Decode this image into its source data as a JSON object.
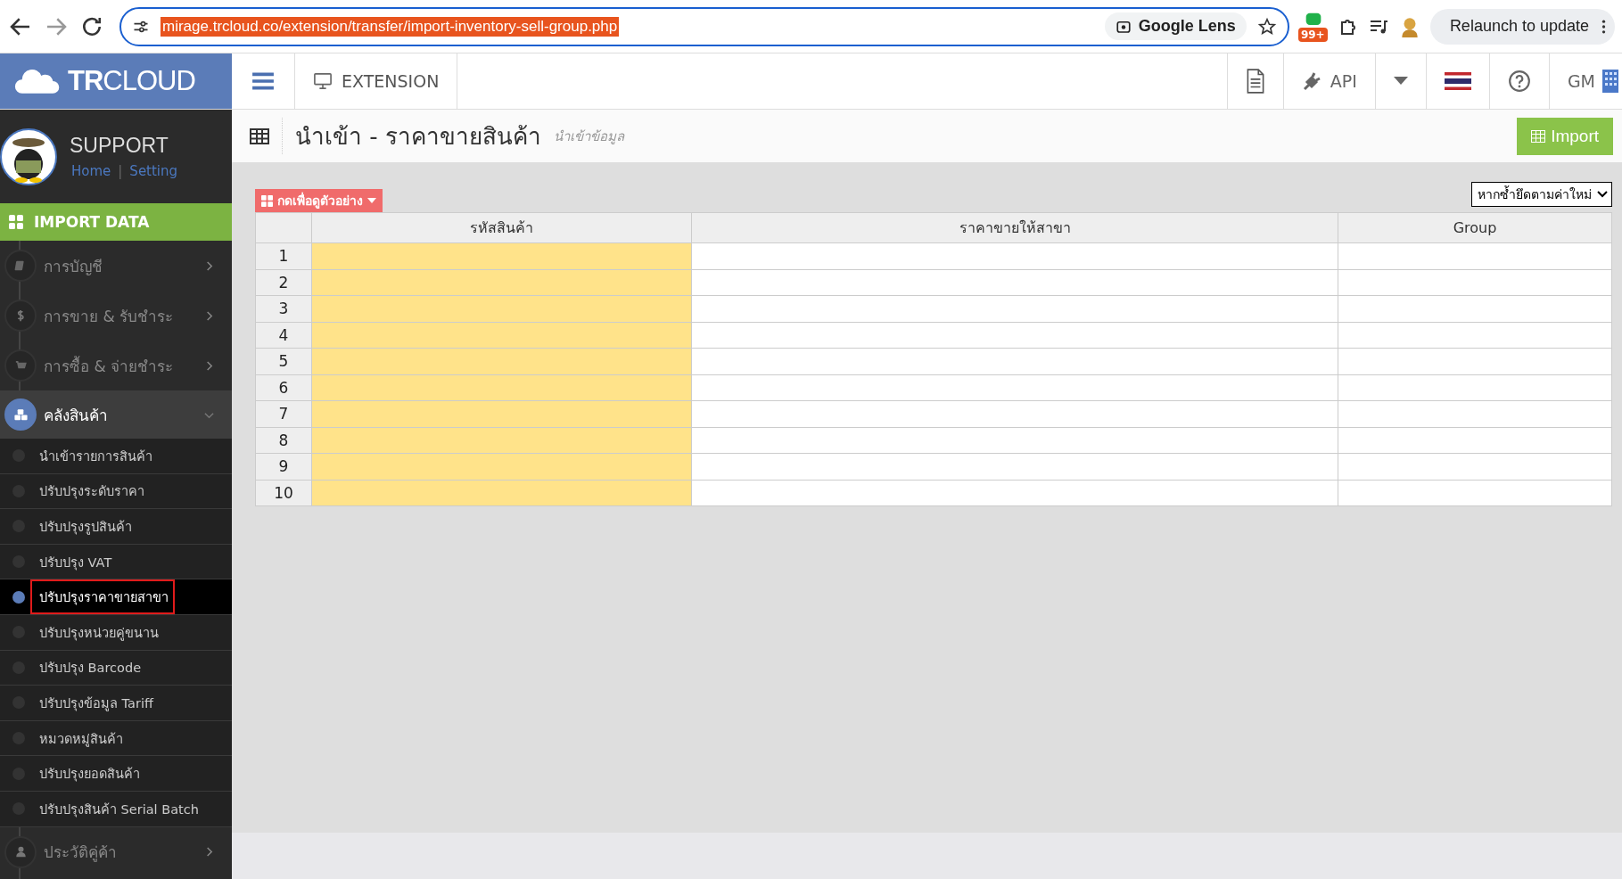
{
  "browser": {
    "url": "mirage.trcloud.co/extension/transfer/import-inventory-sell-group.php",
    "lens": "Google Lens",
    "badge": "99+",
    "relaunch": "Relaunch to update"
  },
  "header": {
    "logo": "**TR**CLOUD",
    "module": "EXTENSION",
    "api": "API",
    "user": "GM"
  },
  "profile": {
    "name": "SUPPORT",
    "links": [
      "Home",
      "Setting"
    ],
    "separator": "|"
  },
  "sidebar": {
    "section": "IMPORT DATA",
    "items": [
      {
        "label": "การบัญชี",
        "expanded": false
      },
      {
        "label": "การขาย & รับชำระ",
        "expanded": false
      },
      {
        "label": "การซื้อ & จ่ายชำระ",
        "expanded": false
      },
      {
        "label": "คลังสินค้า",
        "expanded": true,
        "children": [
          {
            "label": "นำเข้ารายการสินค้า",
            "selected": false
          },
          {
            "label": "ปรับปรุงระดับราคา",
            "selected": false
          },
          {
            "label": "ปรับปรุงรูปสินค้า",
            "selected": false
          },
          {
            "label": "ปรับปรุง VAT",
            "selected": false
          },
          {
            "label": "ปรับปรุงราคาขายสาขา",
            "selected": true
          },
          {
            "label": "ปรับปรุงหน่วยคู่ขนาน",
            "selected": false
          },
          {
            "label": "ปรับปรุง Barcode",
            "selected": false
          },
          {
            "label": "ปรับปรุงข้อมูล Tariff",
            "selected": false
          },
          {
            "label": "หมวดหมู่สินค้า",
            "selected": false
          },
          {
            "label": "ปรับปรุงยอดสินค้า",
            "selected": false
          },
          {
            "label": "ปรับปรุงสินค้า Serial Batch",
            "selected": false
          }
        ]
      },
      {
        "label": "ประวัติคู่ค้า",
        "expanded": false
      }
    ]
  },
  "page": {
    "title": "นำเข้า - ราคาขายสินค้า",
    "subtitle": "นำเข้าข้อมูล",
    "import_button": "Import"
  },
  "example_button": "กดเพื่อดูตัวอย่าง",
  "duplicate_select": "หากซ้ำยึดตามค่าใหม่",
  "table": {
    "columns": [
      "รหัสสินค้า",
      "ราคาขายให้สาขา",
      "Group"
    ],
    "rows": [
      {
        "number": "1"
      },
      {
        "number": "2"
      },
      {
        "number": "3"
      },
      {
        "number": "4"
      },
      {
        "number": "5"
      },
      {
        "number": "6"
      },
      {
        "number": "7"
      },
      {
        "number": "8"
      },
      {
        "number": "9"
      },
      {
        "number": "10"
      }
    ]
  }
}
